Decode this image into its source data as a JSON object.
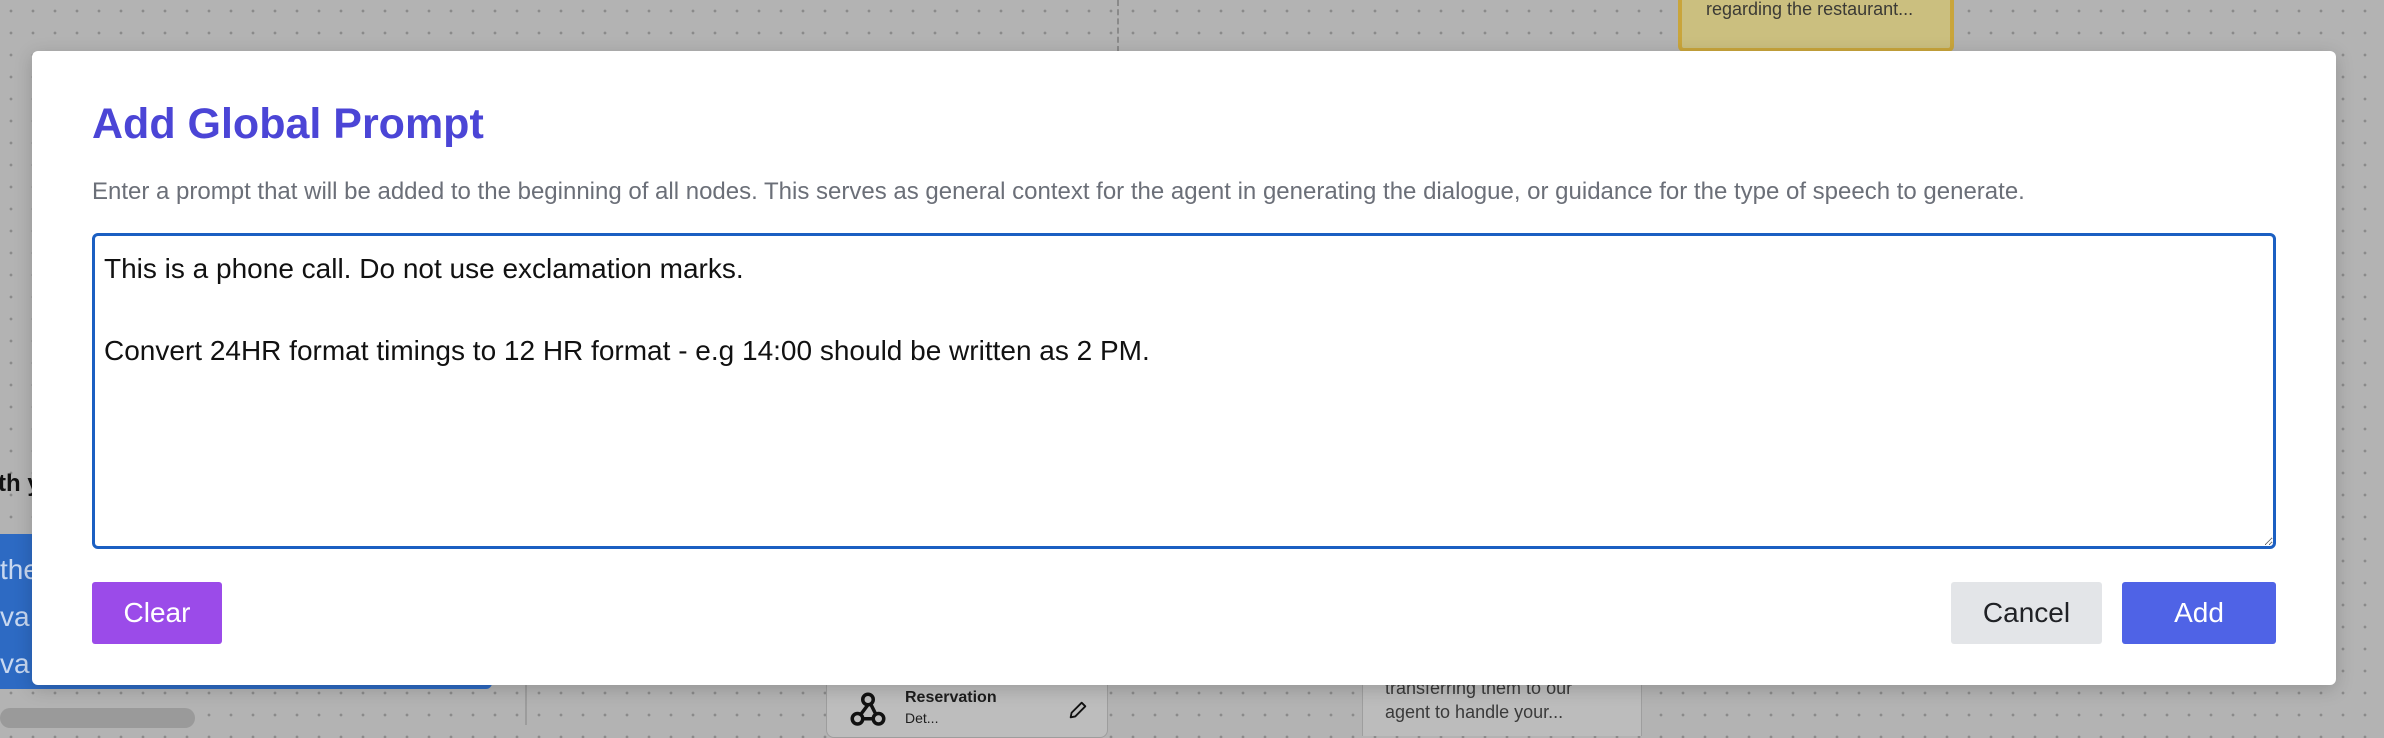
{
  "background": {
    "yellow_card_text": "regarding the restaurant...",
    "left_partial_heading": "th y",
    "left_blue_lines": [
      "the",
      "va",
      "va"
    ],
    "node": {
      "title": "Reservation",
      "subtitle": "Det..."
    },
    "right_card_lines": [
      "transferring them to our",
      "agent to handle your..."
    ]
  },
  "dialog": {
    "title": "Add Global Prompt",
    "description": "Enter a prompt that will be added to the beginning of all nodes. This serves as general context for the agent in generating the dialogue, or guidance for the type of speech to generate.",
    "prompt_value": "This is a phone call. Do not use exclamation marks.\n\nConvert 24HR format timings to 12 HR format - e.g 14:00 should be written as 2 PM.",
    "clear_label": "Clear",
    "cancel_label": "Cancel",
    "add_label": "Add"
  },
  "colors": {
    "title": "#4b45d6",
    "clear_button": "#9b4be9",
    "add_button": "#4f63e6",
    "textarea_border": "#1b5fc2",
    "cancel_button": "#e3e5e8"
  }
}
